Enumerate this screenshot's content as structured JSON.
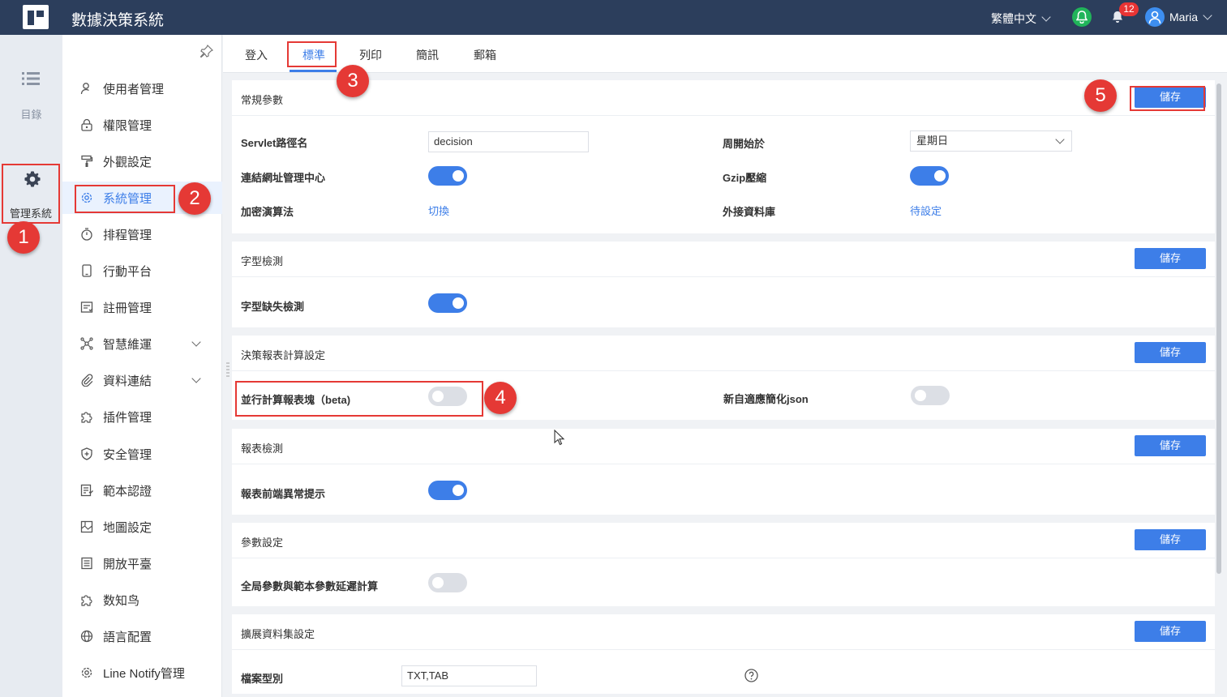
{
  "header": {
    "app_title": "數據決策系統",
    "language": "繁體中文",
    "notification_count": "12",
    "user_name": "Maria"
  },
  "rail": {
    "directory_label": "目錄",
    "admin_label": "管理系統"
  },
  "menu": {
    "items": [
      {
        "label": "使用者管理",
        "icon": "user-icon"
      },
      {
        "label": "權限管理",
        "icon": "lock-icon"
      },
      {
        "label": "外觀設定",
        "icon": "paint-roller-icon"
      },
      {
        "label": "系統管理",
        "icon": "gear-icon"
      },
      {
        "label": "排程管理",
        "icon": "stopwatch-icon"
      },
      {
        "label": "行動平台",
        "icon": "mobile-icon"
      },
      {
        "label": "註冊管理",
        "icon": "register-icon"
      },
      {
        "label": "智慧維運",
        "icon": "network-icon"
      },
      {
        "label": "資料連結",
        "icon": "paperclip-icon"
      },
      {
        "label": "插件管理",
        "icon": "puzzle-icon"
      },
      {
        "label": "安全管理",
        "icon": "shield-icon"
      },
      {
        "label": "範本認證",
        "icon": "template-icon"
      },
      {
        "label": "地圖設定",
        "icon": "map-icon"
      },
      {
        "label": "開放平臺",
        "icon": "document-icon"
      },
      {
        "label": "数知鸟",
        "icon": "puzzle-icon"
      },
      {
        "label": "語言配置",
        "icon": "globe-icon"
      },
      {
        "label": "Line Notify管理",
        "icon": "gear-icon"
      }
    ]
  },
  "tabs": [
    "登入",
    "標準",
    "列印",
    "簡訊",
    "郵箱"
  ],
  "active_tab": "標準",
  "save_label": "儲存",
  "sections": {
    "general": {
      "title": "常規參數",
      "servlet_label": "Servlet路徑名",
      "servlet_value": "decision",
      "week_start_label": "周開始於",
      "week_start_value": "星期日",
      "url_center_label": "連結網址管理中心",
      "gzip_label": "Gzip壓縮",
      "encrypt_label": "加密演算法",
      "encrypt_link": "切換",
      "external_db_label": "外接資料庫",
      "external_db_link": "待設定"
    },
    "font_check": {
      "title": "字型檢測",
      "missing_label": "字型缺失檢測"
    },
    "report_calc": {
      "title": "決策報表計算設定",
      "parallel_label": "並行計算報表塊（beta)",
      "adaptive_label": "新自適應簡化json"
    },
    "report_check": {
      "title": "報表檢測",
      "frontend_label": "報表前端異常提示"
    },
    "param": {
      "title": "參數設定",
      "delay_label": "全局參數與範本參數延遲計算"
    },
    "dataset": {
      "title": "擴展資料集設定",
      "file_type_label": "檔案型別",
      "file_type_value": "TXT,TAB"
    }
  },
  "toggles": {
    "url_center": true,
    "gzip": true,
    "font_missing": true,
    "parallel": false,
    "adaptive_json": false,
    "frontend_error": true,
    "param_delay": false
  },
  "callouts": [
    "1",
    "2",
    "3",
    "4",
    "5"
  ],
  "colors": {
    "topbar": "#2c3e5c",
    "accent": "#3d7ee8",
    "annotation": "#e53935"
  }
}
